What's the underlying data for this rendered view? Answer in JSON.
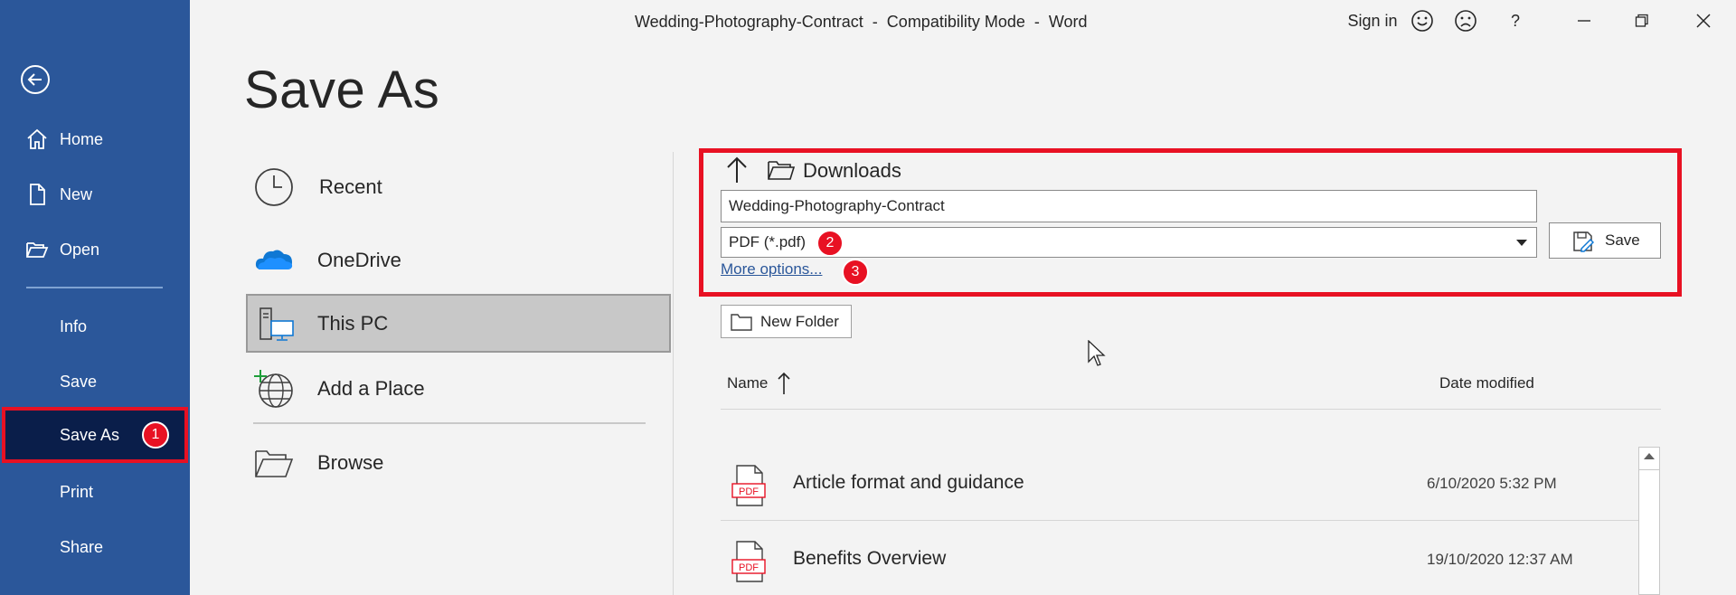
{
  "window": {
    "title": "Wedding-Photography-Contract  -  Compatibility Mode  -  Word",
    "sign_in": "Sign in",
    "help": "?"
  },
  "sidebar": {
    "items": [
      {
        "label": "Home",
        "icon": "home-icon"
      },
      {
        "label": "New",
        "icon": "new-document-icon"
      },
      {
        "label": "Open",
        "icon": "open-folder-icon"
      },
      {
        "label": "Info"
      },
      {
        "label": "Save"
      },
      {
        "label": "Save As",
        "selected": true,
        "badge": "1"
      },
      {
        "label": "Print"
      },
      {
        "label": "Share"
      }
    ]
  },
  "page": {
    "title": "Save As"
  },
  "locations": [
    {
      "label": "Recent",
      "icon": "clock-icon"
    },
    {
      "label": "OneDrive",
      "icon": "cloud-icon"
    },
    {
      "label": "This PC",
      "icon": "pc-icon",
      "selected": true
    },
    {
      "label": "Add a Place",
      "icon": "globe-plus-icon"
    },
    {
      "label": "Browse",
      "icon": "folder-icon"
    }
  ],
  "save_panel": {
    "location": "Downloads",
    "filename": "Wedding-Photography-Contract",
    "filetype": "PDF (*.pdf)",
    "filetype_badge": "2",
    "more_options": "More options...",
    "more_options_badge": "3",
    "save_label": "Save",
    "new_folder_label": "New Folder"
  },
  "file_list": {
    "columns": {
      "name": "Name",
      "date": "Date modified"
    },
    "files": [
      {
        "name": "Article format and guidance",
        "date": "6/10/2020 5:32 PM"
      },
      {
        "name": "Benefits Overview",
        "date": "19/10/2020 12:37 AM"
      }
    ]
  },
  "colors": {
    "sidebar": "#2b579a",
    "selected_nav": "#0a1e4a",
    "highlight": "#e81123",
    "link": "#2b579a"
  }
}
